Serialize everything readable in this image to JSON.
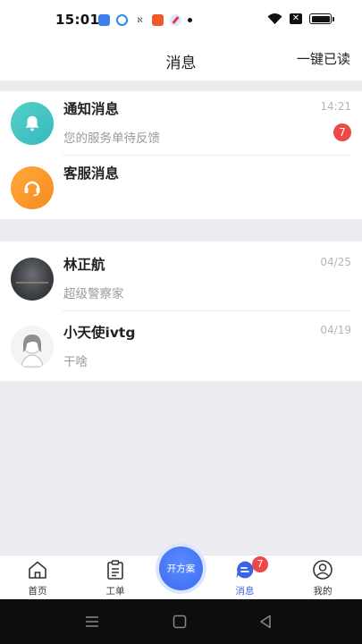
{
  "statusbar": {
    "time": "15:01",
    "notif_icons": [
      "app-icon",
      "app-icon",
      "sim-icon",
      "app-icon",
      "compass-icon"
    ],
    "right_icons": [
      "wifi-icon",
      "no-sim-icon",
      "battery-icon"
    ]
  },
  "header": {
    "title": "消息",
    "action_label": "一键已读"
  },
  "system_messages": [
    {
      "title": "通知消息",
      "subtitle": "您的服务单待反馈",
      "time": "14:21",
      "badge": "7",
      "icon": "bell-icon"
    },
    {
      "title": "客服消息",
      "subtitle": "",
      "time": "",
      "icon": "headset-icon"
    }
  ],
  "chats": [
    {
      "title": "林正航",
      "subtitle": "超级警察家",
      "time": "04/25"
    },
    {
      "title": "小天使ivtg",
      "subtitle": "干啥",
      "time": "04/19"
    }
  ],
  "tabbar": {
    "tabs": [
      {
        "label": "首页",
        "icon": "home-icon"
      },
      {
        "label": "工单",
        "icon": "clipboard-icon"
      },
      {
        "label": "开方案",
        "icon": "plan-button"
      },
      {
        "label": "消息",
        "icon": "message-icon",
        "badge": "7",
        "active": true
      },
      {
        "label": "我的",
        "icon": "profile-icon"
      }
    ]
  },
  "colors": {
    "accent": "#3a63e6",
    "badge": "#ee4848",
    "background": "#ececf1"
  }
}
